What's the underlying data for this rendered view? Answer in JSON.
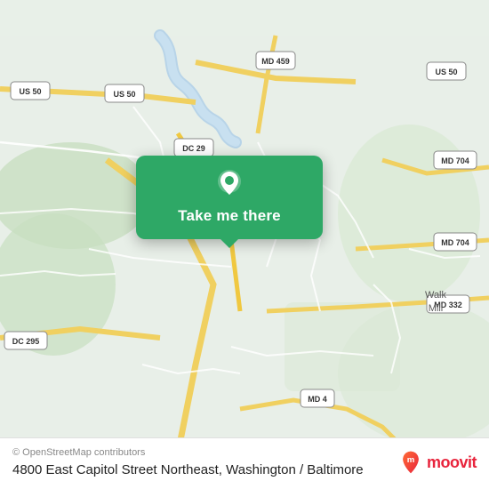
{
  "map": {
    "attribution": "© OpenStreetMap contributors",
    "location_name": "4800 East Capitol Street Northeast, Washington / Baltimore",
    "button_label": "Take me there",
    "pin_icon": "location-pin",
    "bg_color": "#e8f0e8"
  },
  "moovit": {
    "brand": "moovit",
    "logo_alt": "Moovit logo"
  }
}
